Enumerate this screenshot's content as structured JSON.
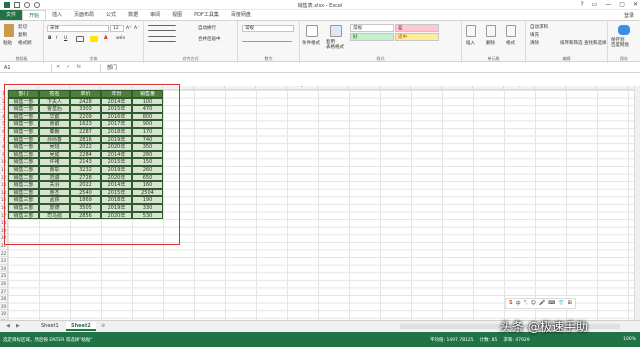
{
  "window": {
    "title": "销售表.xlsx - Excel",
    "controls": [
      "?",
      "▭",
      "—",
      "▢",
      "✕"
    ],
    "login": "登录"
  },
  "tabs": [
    "文件",
    "开始",
    "插入",
    "页面布局",
    "公式",
    "数据",
    "审阅",
    "视图",
    "PDF工具集",
    "百度网盘"
  ],
  "active_tab": "开始",
  "ribbon": {
    "clipboard": {
      "label": "剪贴板",
      "paste": "粘贴",
      "cut": "剪切",
      "copy": "复制",
      "painter": "格式刷"
    },
    "font": {
      "label": "字体",
      "name": "宋体",
      "size": "12",
      "bold": "B",
      "italic": "I",
      "underline": "U",
      "inc": "A⁺",
      "dec": "A⁻",
      "color_char": "A",
      "wen": "wén"
    },
    "align": {
      "label": "对齐方式",
      "wrap": "自动换行",
      "merge": "合并后居中"
    },
    "number": {
      "label": "数字",
      "format": "常规"
    },
    "styles": {
      "label": "样式",
      "cond": "条件格式",
      "table": "套用\n表格格式",
      "normal": "常规",
      "bad": "差",
      "good": "好",
      "neutral": "适中"
    },
    "cells": {
      "label": "单元格",
      "insert": "插入",
      "delete": "删除",
      "format": "格式"
    },
    "edit": {
      "label": "编辑",
      "autosum": "自动求和",
      "fill": "填充",
      "clear": "清除",
      "sort": "排序和筛选",
      "find": "查找和选择"
    },
    "save": {
      "label": "保存",
      "baidu": "保存到\n百度网盘"
    }
  },
  "formula_bar": {
    "name_box": "A1",
    "cancel": "✕",
    "enter": "✓",
    "fx": "fx",
    "value": "部门"
  },
  "columns": [
    "A",
    "B",
    "C",
    "D",
    "E",
    "F",
    "G",
    "H",
    "I",
    "J",
    "K",
    "L",
    "M",
    "N",
    "O",
    "P",
    "Q",
    "R",
    "S",
    "T",
    "U"
  ],
  "rows": [
    "1",
    "2",
    "3",
    "4",
    "5",
    "6",
    "7",
    "8",
    "9",
    "10",
    "11",
    "12",
    "13",
    "14",
    "15",
    "16",
    "17",
    "18",
    "19",
    "20",
    "21",
    "22",
    "23",
    "24",
    "25",
    "26",
    "27",
    "28",
    "29",
    "30",
    "31"
  ],
  "table": {
    "headers": [
      "部门",
      "姓名",
      "单价",
      "年份",
      "销售量"
    ],
    "rows": [
      [
        "销售一部",
        "卞夫人",
        "2428",
        "2014年",
        "100"
      ],
      [
        "销售一部",
        "曹皇后",
        "3303",
        "2015年",
        "470"
      ],
      [
        "销售一部",
        "华歆",
        "2209",
        "2016年",
        "800"
      ],
      [
        "销售一部",
        "曹叡",
        "1623",
        "2017年",
        "900"
      ],
      [
        "销售一部",
        "秦朗",
        "2287",
        "2018年",
        "170"
      ],
      [
        "销售一部",
        "孙尚香",
        "2816",
        "2019年",
        "740"
      ],
      [
        "销售一部",
        "吴班",
        "2022",
        "2020年",
        "350"
      ],
      [
        "销售二部",
        "吴懿",
        "2284",
        "2014年",
        "280"
      ],
      [
        "销售二部",
        "许褚",
        "2143",
        "2015年",
        "150"
      ],
      [
        "销售二部",
        "曹彰",
        "3232",
        "2019年",
        "260"
      ],
      [
        "销售二部",
        "范疆",
        "2728",
        "2020年",
        "650"
      ],
      [
        "销售二部",
        "关羽",
        "2022",
        "2014年",
        "160"
      ],
      [
        "销售二部",
        "曹丕",
        "2540",
        "2015年",
        "2504"
      ],
      [
        "销售三部",
        "孟获",
        "1869",
        "2018年",
        "190"
      ],
      [
        "销售三部",
        "庞德",
        "3505",
        "2019年",
        "330"
      ],
      [
        "销售三部",
        "司马懿",
        "2856",
        "2020年",
        "530"
      ]
    ]
  },
  "sheets": [
    "Sheet1",
    "Sheet2"
  ],
  "active_sheet": "Sheet2",
  "add_sheet": "⊕",
  "status": {
    "message": "选定目标区域，然后按 ENTER 或选择\"粘贴\"",
    "average": "平均值: 1497.78125",
    "count": "计数: 85",
    "sum": "求和: 47929",
    "zoom": "100%"
  },
  "ime": [
    "S",
    "中",
    "°,",
    "☺",
    "🎤",
    "⌨",
    "👕",
    "⊞"
  ],
  "watermark": "头条 @极速手助"
}
